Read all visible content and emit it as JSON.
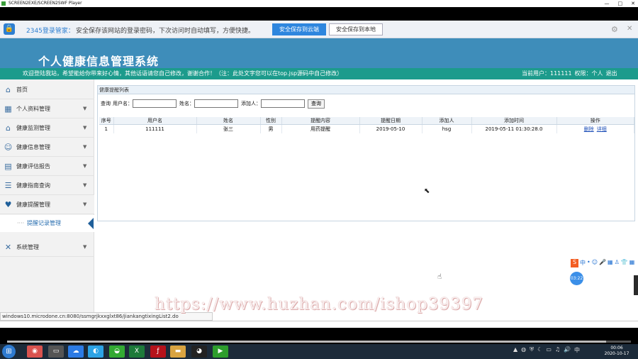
{
  "player": {
    "title": "SCREEN2EXE/SCREEN2SWF Player",
    "controls": [
      "—",
      "□",
      "✕"
    ]
  },
  "password_bar": {
    "brand": "2345登录管家：",
    "message": "安全保存该网站的登录密码，下次访问时自动填写，方便快捷。",
    "cloud_button": "安全保存到云端",
    "local_button": "安全保存到本地"
  },
  "site": {
    "title": "个人健康信息管理系统",
    "welcome": "欢迎登陆我站，希望能给你带来好心情，其他话语请您自己修改，谢谢合作！（注：此处文字您可以在top.jsp源码中自己修改）",
    "current_user": "当前用户：111111",
    "role": "权限：个人",
    "logout": "退出"
  },
  "sidebar": {
    "items": [
      {
        "label": "首页",
        "icon": "home-icon",
        "glyph": "⌂",
        "has_arrow": false
      },
      {
        "label": "个人资料管理",
        "icon": "grid-icon",
        "glyph": "▦",
        "has_arrow": true
      },
      {
        "label": "健康监测管理",
        "icon": "house-icon",
        "glyph": "⌂",
        "has_arrow": true
      },
      {
        "label": "健康信息管理",
        "icon": "user-icon",
        "glyph": "☺",
        "has_arrow": true
      },
      {
        "label": "健康评估报告",
        "icon": "file-icon",
        "glyph": "▤",
        "has_arrow": true
      },
      {
        "label": "健康指南查询",
        "icon": "chat-icon",
        "glyph": "☰",
        "has_arrow": true
      },
      {
        "label": "健康提醒管理",
        "icon": "heart-icon",
        "glyph": "♥",
        "has_arrow": true
      },
      {
        "label": "系统管理",
        "icon": "tools-icon",
        "glyph": "✕",
        "has_arrow": true
      }
    ],
    "sub_item": "提醒记录管理",
    "sub_dash": "····"
  },
  "main": {
    "panel_title": "健康提醒列表",
    "search": {
      "prefix": "查询",
      "username_label": "用户名：",
      "name_label": "姓名：",
      "adder_label": "添加人：",
      "username_value": "",
      "name_value": "",
      "adder_value": "",
      "query_button": "查询"
    },
    "table": {
      "headers": [
        "序号",
        "用户名",
        "姓名",
        "性别",
        "提醒内容",
        "提醒日期",
        "添加人",
        "添加时间",
        "操作"
      ],
      "rows": [
        {
          "index": "1",
          "username": "111111",
          "name": "张三",
          "gender": "男",
          "content": "用药提醒",
          "date": "2019-05-10",
          "adder": "hsg",
          "added_time": "2019-05-11 01:30:28.0",
          "actions": [
            "删除",
            "详细"
          ]
        }
      ]
    }
  },
  "status": {
    "url": "windows10.microdone.cn:8080/ssmgrjkxxglxt86/jiankangtixingList2.do"
  },
  "watermark": "https://www.huzhan.com/ishop39397",
  "ime": {
    "logo": "S",
    "items": [
      "中",
      "•",
      "☺",
      "🎤",
      "▦",
      "♙",
      "👕",
      "▦"
    ],
    "bubble_time": "03:22"
  },
  "taskbar": {
    "start": "⊞",
    "apps": [
      {
        "name": "chrome-icon",
        "glyph": "◉",
        "color": "#d9534f"
      },
      {
        "name": "media-icon",
        "glyph": "▭",
        "color": "#555"
      },
      {
        "name": "cloud-icon",
        "glyph": "☁",
        "color": "#2c7be5"
      },
      {
        "name": "app-icon",
        "glyph": "◐",
        "color": "#2ca3e5"
      },
      {
        "name": "360-icon",
        "glyph": "◒",
        "color": "#33aa33"
      },
      {
        "name": "excel-icon",
        "glyph": "X",
        "color": "#1d7a3a"
      },
      {
        "name": "flash-icon",
        "glyph": "ƒ",
        "color": "#b5121b"
      },
      {
        "name": "folder-icon",
        "glyph": "▬",
        "color": "#d9a441"
      },
      {
        "name": "qq-icon",
        "glyph": "◕",
        "color": "#222"
      },
      {
        "name": "player-icon",
        "glyph": "▶",
        "color": "#2d9d2d"
      }
    ],
    "tray": [
      "▲",
      "◍",
      "⛨",
      "☾",
      "▭",
      "♫",
      "🔊",
      "中"
    ],
    "time": "00:06",
    "date": "2020-10-17"
  },
  "colors": {
    "header": "#3e8dba",
    "info_bar": "#1c9b8c",
    "link": "#1d4fb8",
    "cloud_button": "#2e86de"
  }
}
